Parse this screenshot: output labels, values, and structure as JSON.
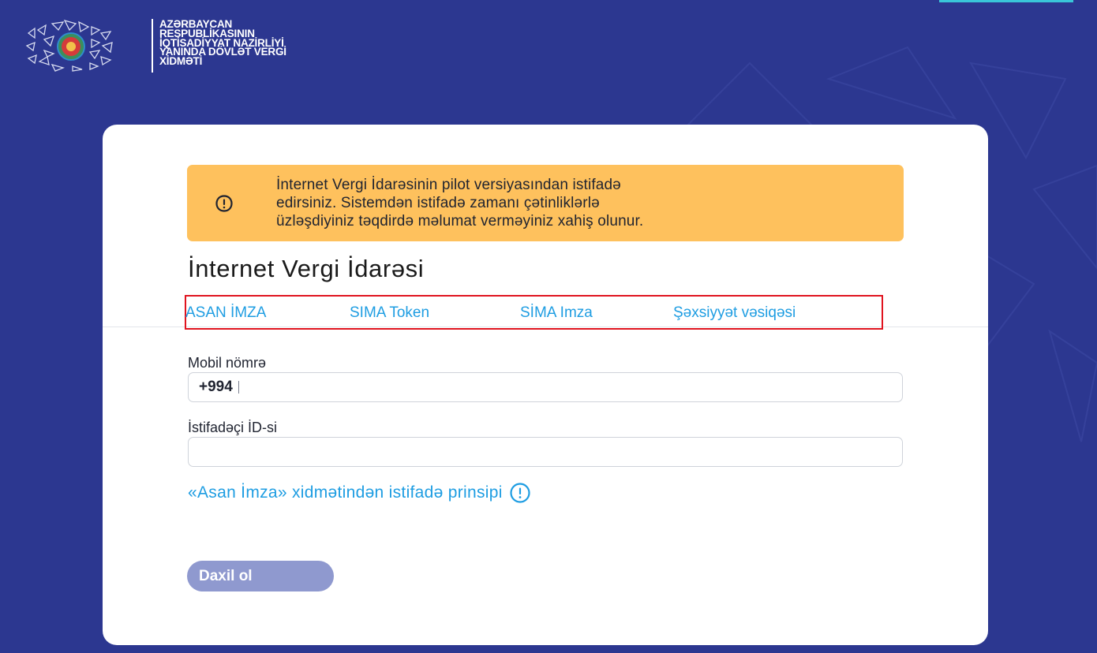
{
  "header": {
    "org_lines": [
      "AZƏRBAYCAN",
      "RESPUBLİKASININ",
      "İQTİSADİYYAT NAZİRLİYİ",
      "YANINDA DÖVLƏT VERGİ",
      "XİDMƏTİ"
    ],
    "emblem_icon": "azerbaijan-emblem-icon"
  },
  "notice": {
    "icon": "exclamation-circle-icon",
    "lines": [
      "İnternet Vergi İdarəsinin pilot versiyasından istifadə",
      "edirsiniz. Sistemdən istifadə zamanı çətinliklərlə",
      "üzləşdiyiniz təqdirdə məlumat verməyiniz xahiş olunur."
    ]
  },
  "title": "İnternet Vergi İdarəsi",
  "tabs": [
    "ASAN İMZA",
    "SIMA Token",
    "SİMA Imza",
    "Şəxsiyyət vəsiqəsi"
  ],
  "form": {
    "phone_label": "Mobil nömrə",
    "phone_prefix": "+994",
    "phone_value": "",
    "userid_label": "İstifadəçi İD-si",
    "userid_value": ""
  },
  "help_link": "«Asan İmza» xidmətindən istifadə prinsipi",
  "submit_label": "Daxil ol",
  "colors": {
    "background": "#2c3790",
    "notice": "#fec15d",
    "link": "#1e9de2",
    "button_disabled": "#8f99cf",
    "highlight": "#e0141f"
  }
}
